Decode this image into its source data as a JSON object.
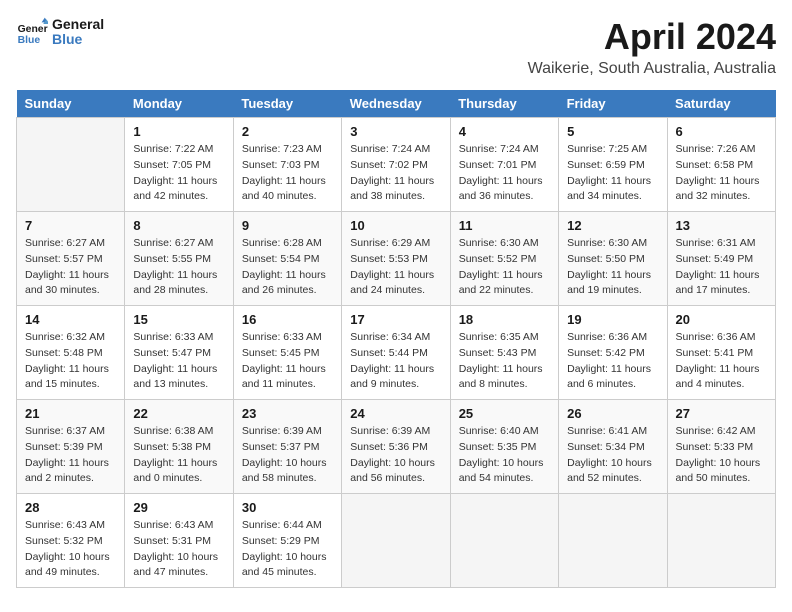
{
  "header": {
    "logo_line1": "General",
    "logo_line2": "Blue",
    "title": "April 2024",
    "subtitle": "Waikerie, South Australia, Australia"
  },
  "weekdays": [
    "Sunday",
    "Monday",
    "Tuesday",
    "Wednesday",
    "Thursday",
    "Friday",
    "Saturday"
  ],
  "weeks": [
    [
      {
        "day": "",
        "sunrise": "",
        "sunset": "",
        "daylight": ""
      },
      {
        "day": "1",
        "sunrise": "Sunrise: 7:22 AM",
        "sunset": "Sunset: 7:05 PM",
        "daylight": "Daylight: 11 hours and 42 minutes."
      },
      {
        "day": "2",
        "sunrise": "Sunrise: 7:23 AM",
        "sunset": "Sunset: 7:03 PM",
        "daylight": "Daylight: 11 hours and 40 minutes."
      },
      {
        "day": "3",
        "sunrise": "Sunrise: 7:24 AM",
        "sunset": "Sunset: 7:02 PM",
        "daylight": "Daylight: 11 hours and 38 minutes."
      },
      {
        "day": "4",
        "sunrise": "Sunrise: 7:24 AM",
        "sunset": "Sunset: 7:01 PM",
        "daylight": "Daylight: 11 hours and 36 minutes."
      },
      {
        "day": "5",
        "sunrise": "Sunrise: 7:25 AM",
        "sunset": "Sunset: 6:59 PM",
        "daylight": "Daylight: 11 hours and 34 minutes."
      },
      {
        "day": "6",
        "sunrise": "Sunrise: 7:26 AM",
        "sunset": "Sunset: 6:58 PM",
        "daylight": "Daylight: 11 hours and 32 minutes."
      }
    ],
    [
      {
        "day": "7",
        "sunrise": "Sunrise: 6:27 AM",
        "sunset": "Sunset: 5:57 PM",
        "daylight": "Daylight: 11 hours and 30 minutes."
      },
      {
        "day": "8",
        "sunrise": "Sunrise: 6:27 AM",
        "sunset": "Sunset: 5:55 PM",
        "daylight": "Daylight: 11 hours and 28 minutes."
      },
      {
        "day": "9",
        "sunrise": "Sunrise: 6:28 AM",
        "sunset": "Sunset: 5:54 PM",
        "daylight": "Daylight: 11 hours and 26 minutes."
      },
      {
        "day": "10",
        "sunrise": "Sunrise: 6:29 AM",
        "sunset": "Sunset: 5:53 PM",
        "daylight": "Daylight: 11 hours and 24 minutes."
      },
      {
        "day": "11",
        "sunrise": "Sunrise: 6:30 AM",
        "sunset": "Sunset: 5:52 PM",
        "daylight": "Daylight: 11 hours and 22 minutes."
      },
      {
        "day": "12",
        "sunrise": "Sunrise: 6:30 AM",
        "sunset": "Sunset: 5:50 PM",
        "daylight": "Daylight: 11 hours and 19 minutes."
      },
      {
        "day": "13",
        "sunrise": "Sunrise: 6:31 AM",
        "sunset": "Sunset: 5:49 PM",
        "daylight": "Daylight: 11 hours and 17 minutes."
      }
    ],
    [
      {
        "day": "14",
        "sunrise": "Sunrise: 6:32 AM",
        "sunset": "Sunset: 5:48 PM",
        "daylight": "Daylight: 11 hours and 15 minutes."
      },
      {
        "day": "15",
        "sunrise": "Sunrise: 6:33 AM",
        "sunset": "Sunset: 5:47 PM",
        "daylight": "Daylight: 11 hours and 13 minutes."
      },
      {
        "day": "16",
        "sunrise": "Sunrise: 6:33 AM",
        "sunset": "Sunset: 5:45 PM",
        "daylight": "Daylight: 11 hours and 11 minutes."
      },
      {
        "day": "17",
        "sunrise": "Sunrise: 6:34 AM",
        "sunset": "Sunset: 5:44 PM",
        "daylight": "Daylight: 11 hours and 9 minutes."
      },
      {
        "day": "18",
        "sunrise": "Sunrise: 6:35 AM",
        "sunset": "Sunset: 5:43 PM",
        "daylight": "Daylight: 11 hours and 8 minutes."
      },
      {
        "day": "19",
        "sunrise": "Sunrise: 6:36 AM",
        "sunset": "Sunset: 5:42 PM",
        "daylight": "Daylight: 11 hours and 6 minutes."
      },
      {
        "day": "20",
        "sunrise": "Sunrise: 6:36 AM",
        "sunset": "Sunset: 5:41 PM",
        "daylight": "Daylight: 11 hours and 4 minutes."
      }
    ],
    [
      {
        "day": "21",
        "sunrise": "Sunrise: 6:37 AM",
        "sunset": "Sunset: 5:39 PM",
        "daylight": "Daylight: 11 hours and 2 minutes."
      },
      {
        "day": "22",
        "sunrise": "Sunrise: 6:38 AM",
        "sunset": "Sunset: 5:38 PM",
        "daylight": "Daylight: 11 hours and 0 minutes."
      },
      {
        "day": "23",
        "sunrise": "Sunrise: 6:39 AM",
        "sunset": "Sunset: 5:37 PM",
        "daylight": "Daylight: 10 hours and 58 minutes."
      },
      {
        "day": "24",
        "sunrise": "Sunrise: 6:39 AM",
        "sunset": "Sunset: 5:36 PM",
        "daylight": "Daylight: 10 hours and 56 minutes."
      },
      {
        "day": "25",
        "sunrise": "Sunrise: 6:40 AM",
        "sunset": "Sunset: 5:35 PM",
        "daylight": "Daylight: 10 hours and 54 minutes."
      },
      {
        "day": "26",
        "sunrise": "Sunrise: 6:41 AM",
        "sunset": "Sunset: 5:34 PM",
        "daylight": "Daylight: 10 hours and 52 minutes."
      },
      {
        "day": "27",
        "sunrise": "Sunrise: 6:42 AM",
        "sunset": "Sunset: 5:33 PM",
        "daylight": "Daylight: 10 hours and 50 minutes."
      }
    ],
    [
      {
        "day": "28",
        "sunrise": "Sunrise: 6:43 AM",
        "sunset": "Sunset: 5:32 PM",
        "daylight": "Daylight: 10 hours and 49 minutes."
      },
      {
        "day": "29",
        "sunrise": "Sunrise: 6:43 AM",
        "sunset": "Sunset: 5:31 PM",
        "daylight": "Daylight: 10 hours and 47 minutes."
      },
      {
        "day": "30",
        "sunrise": "Sunrise: 6:44 AM",
        "sunset": "Sunset: 5:29 PM",
        "daylight": "Daylight: 10 hours and 45 minutes."
      },
      {
        "day": "",
        "sunrise": "",
        "sunset": "",
        "daylight": ""
      },
      {
        "day": "",
        "sunrise": "",
        "sunset": "",
        "daylight": ""
      },
      {
        "day": "",
        "sunrise": "",
        "sunset": "",
        "daylight": ""
      },
      {
        "day": "",
        "sunrise": "",
        "sunset": "",
        "daylight": ""
      }
    ]
  ]
}
